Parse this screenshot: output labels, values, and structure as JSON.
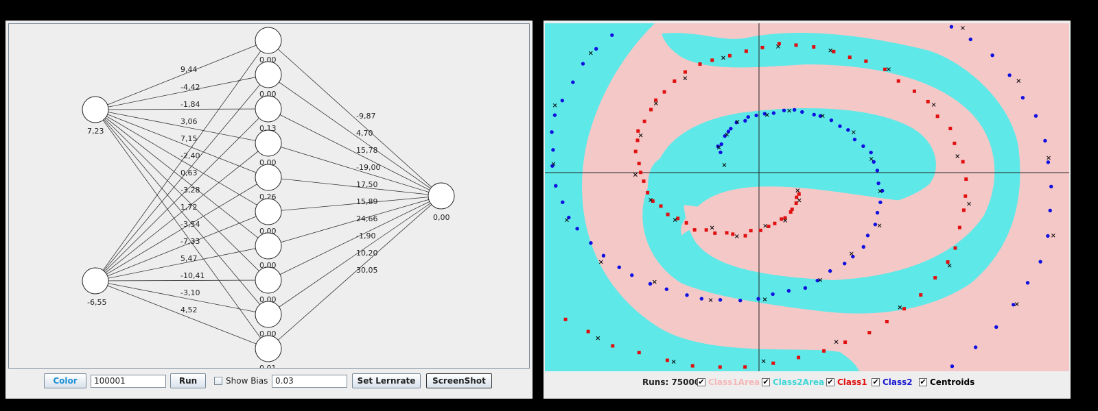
{
  "network": {
    "inputs": [
      {
        "label": "7,23"
      },
      {
        "label": "-6,55"
      }
    ],
    "hidden_labels": [
      "0,00",
      "0,00",
      "0,13",
      "0,00",
      "0,26",
      "0,00",
      "0,00",
      "0,00",
      "0,00",
      "0,01"
    ],
    "output": {
      "label": "0,00"
    },
    "weights_in_visible": [
      "9,44",
      "-4,42",
      "-1,84",
      "3,06",
      "7,15",
      "-2,40",
      "0,63",
      "-3,28",
      "1,72",
      "-3,54",
      "-7,33",
      "5,47",
      "-10,41",
      "-3,10",
      "4,52"
    ],
    "weights_out": [
      "-9,87",
      "4,70",
      "15,78",
      "-19,00",
      "17,50",
      "15,89",
      "24,66",
      "-1,90",
      "10,20",
      "30,05"
    ],
    "colors": {
      "node_fill": "#ffffff",
      "edge": "#333333"
    }
  },
  "toolbar": {
    "color_label": "Color",
    "runs_value": "100001",
    "run_label": "Run",
    "show_bias_label": "Show Bias",
    "learnrate_value": "0.03",
    "set_learnrate_label": "Set Lernrate",
    "screenshot_label": "ScreenShot"
  },
  "plot": {
    "colors": {
      "class1_area": "#f5c8c8",
      "class2_area": "#5ee8e8",
      "class1": "#e01010",
      "class2": "#1010e0",
      "centroids": "#000000"
    }
  },
  "legend": {
    "runs": "Runs: 75000",
    "items": [
      {
        "label": "Class1Area",
        "checked": "✔",
        "color": "#f5b8b8"
      },
      {
        "label": "Class2Area",
        "checked": "✔",
        "color": "#3fd6d6"
      },
      {
        "label": "Class1",
        "checked": "✔",
        "color": "#e01010"
      },
      {
        "label": "Class2",
        "checked": "✔",
        "color": "#1a1ad0"
      },
      {
        "label": "Centroids",
        "checked": "✔",
        "color": "#000000"
      }
    ]
  }
}
